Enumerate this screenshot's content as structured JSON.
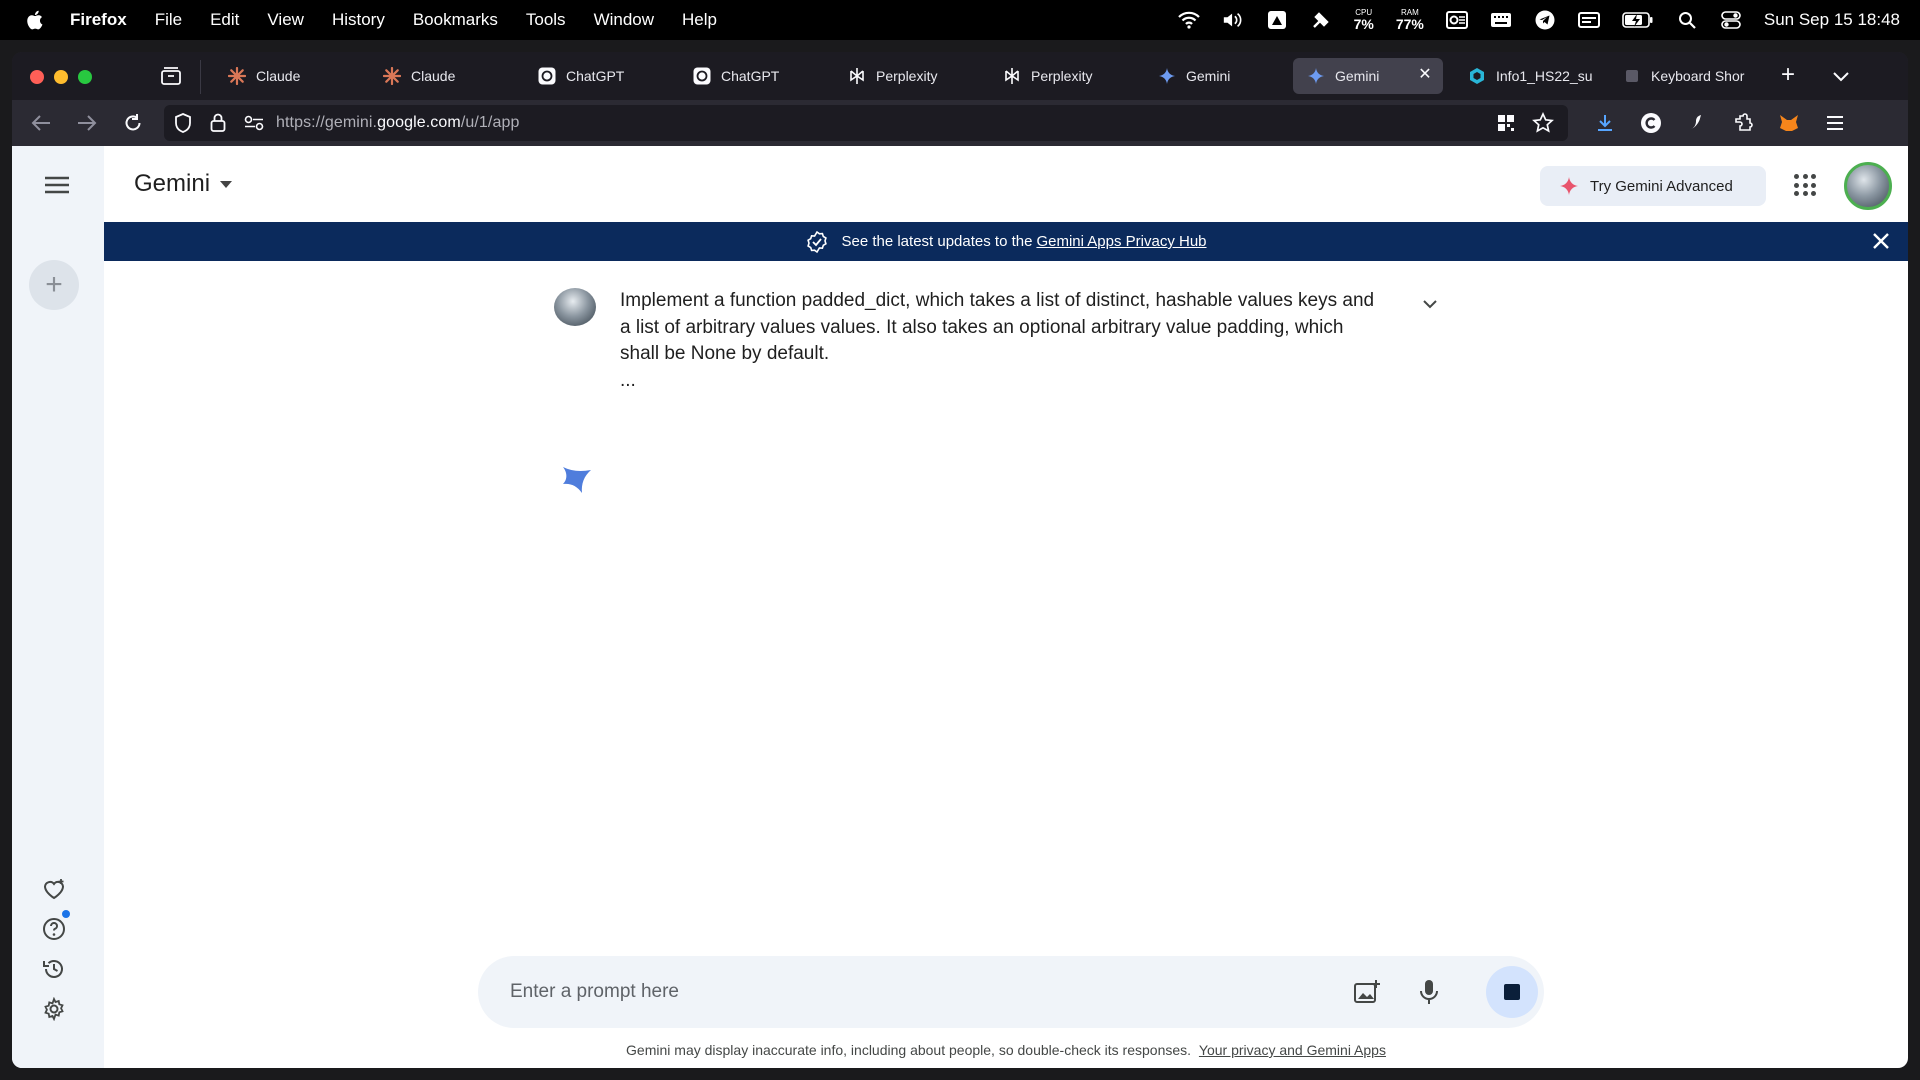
{
  "menubar": {
    "app_name": "Firefox",
    "menus": [
      "File",
      "Edit",
      "View",
      "History",
      "Bookmarks",
      "Tools",
      "Window",
      "Help"
    ],
    "cpu_label": "CPU",
    "cpu_value": "7%",
    "ram_label": "RAM",
    "ram_value": "77%",
    "clock": "Sun Sep 15  18:48"
  },
  "tabs": [
    {
      "title": "Claude",
      "icon": "claude-icon",
      "active": false
    },
    {
      "title": "Claude",
      "icon": "claude-icon",
      "active": false
    },
    {
      "title": "ChatGPT",
      "icon": "chatgpt-icon",
      "active": false
    },
    {
      "title": "ChatGPT",
      "icon": "chatgpt-icon",
      "active": false
    },
    {
      "title": "Perplexity",
      "icon": "perplexity-icon",
      "active": false
    },
    {
      "title": "Perplexity",
      "icon": "perplexity-icon",
      "active": false
    },
    {
      "title": "Gemini",
      "icon": "gemini-icon",
      "active": false
    },
    {
      "title": "Gemini",
      "icon": "gemini-icon",
      "active": true
    },
    {
      "title": "Info1_HS22_su",
      "icon": "hexagon-icon",
      "active": false
    },
    {
      "title": "Keyboard Shor",
      "icon": "doc-icon",
      "active": false
    }
  ],
  "navbar": {
    "url_prefix": "https://gemini.",
    "url_host": "google.com",
    "url_path": "/u/1/app"
  },
  "page": {
    "brand": "Gemini",
    "try_advanced": "Try Gemini Advanced",
    "banner_text": "See the latest updates to the",
    "banner_link": "Gemini Apps Privacy Hub",
    "prompt_text": "Implement a function padded_dict, which takes a list of distinct, hashable values keys and a list of arbitrary values values. It also takes an optional arbitrary value padding, which shall be None by default.",
    "prompt_ellipsis": "...",
    "composer_placeholder": "Enter a prompt here",
    "disclaimer_text": "Gemini may display inaccurate info, including about people, so double-check its responses.",
    "disclaimer_link": "Your privacy and Gemini Apps"
  },
  "colors": {
    "banner_bg": "#0b2a5c",
    "sidebar_bg": "#f0f4f9",
    "gemini_blue": "#4f7ddc",
    "tab_active": "#42414d"
  }
}
